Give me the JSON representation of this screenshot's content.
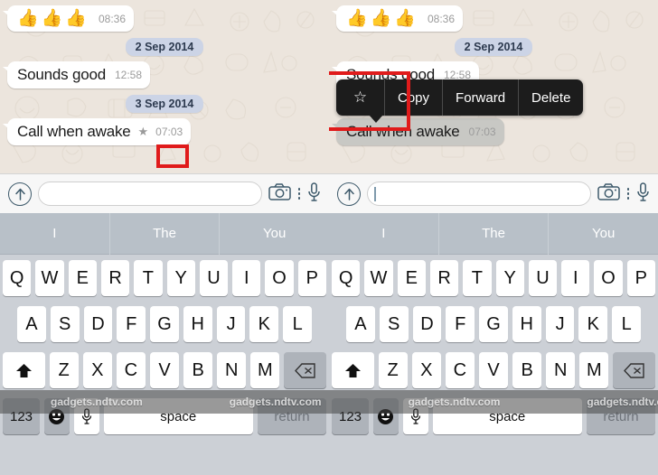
{
  "panels": [
    {
      "id": "before",
      "messages": [
        {
          "type": "emoji",
          "text": "👍👍👍",
          "time": "08:36",
          "starred": false,
          "selected": false
        },
        {
          "type": "date",
          "text": "2 Sep 2014"
        },
        {
          "type": "text",
          "text": "Sounds good",
          "time": "12:58",
          "starred": false,
          "selected": false
        },
        {
          "type": "date",
          "text": "3 Sep 2014"
        },
        {
          "type": "text",
          "text": "Call when awake",
          "time": "07:03",
          "starred": true,
          "selected": false
        }
      ],
      "menu": null,
      "input": {
        "value": "",
        "placeholder": "",
        "caret": false
      }
    },
    {
      "id": "after",
      "messages": [
        {
          "type": "emoji",
          "text": "👍👍👍",
          "time": "08:36",
          "starred": false,
          "selected": false
        },
        {
          "type": "date",
          "text": "2 Sep 2014"
        },
        {
          "type": "text",
          "text": "Sounds good",
          "time": "12:58",
          "starred": false,
          "selected": false
        },
        {
          "type": "date",
          "text": "3 Sep 2014"
        },
        {
          "type": "text",
          "text": "Call when awake",
          "time": "07:03",
          "starred": false,
          "selected": true
        }
      ],
      "menu": {
        "star_glyph": "☆",
        "items": [
          "Copy",
          "Forward",
          "Delete"
        ]
      },
      "input": {
        "value": "",
        "placeholder": "",
        "caret": true
      }
    }
  ],
  "icons": {
    "attach": "up-arrow-circle-icon",
    "camera": "camera-icon",
    "overflow": "more-vertical-icon",
    "mic": "microphone-icon",
    "shift": "shift-icon",
    "backspace": "backspace-icon",
    "emoji_glyph": "☺"
  },
  "suggestions": [
    "I",
    "The",
    "You"
  ],
  "keyboard": {
    "row1": [
      "Q",
      "W",
      "E",
      "R",
      "T",
      "Y",
      "U",
      "I",
      "O",
      "P"
    ],
    "row2": [
      "A",
      "S",
      "D",
      "F",
      "G",
      "H",
      "J",
      "K",
      "L"
    ],
    "row3": [
      "Z",
      "X",
      "C",
      "V",
      "B",
      "N",
      "M"
    ],
    "numeric_label": "123",
    "space_label": "space",
    "return_label": "return"
  },
  "watermark": {
    "text": "gadgets.ndtv.com",
    "repeat": 9
  },
  "colors": {
    "highlight": "#e01b1b",
    "menu_bg": "#1c1c1c",
    "bubble_in": "#ffffff",
    "bubble_selected": "#c8c8c4",
    "date_pill": "#ccd4e6",
    "chat_bg": "#ece5dd",
    "keyboard_bg": "#ccd0d6",
    "suggestion_bg": "#b8c0c8"
  }
}
